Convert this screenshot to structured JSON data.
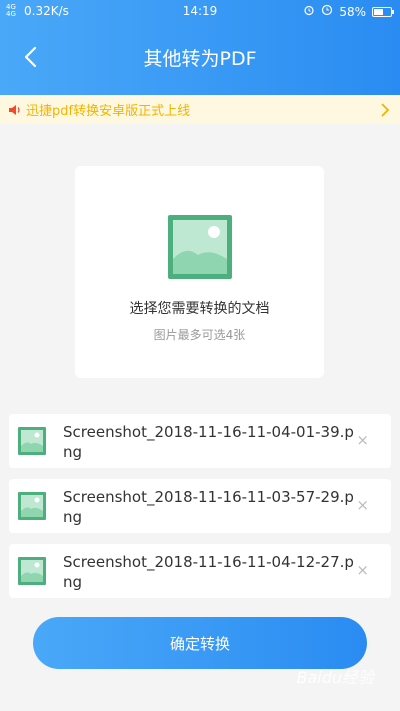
{
  "status_bar": {
    "network": "4G 4G",
    "speed": "0.32K/s",
    "time": "14:19",
    "battery": "58%"
  },
  "header": {
    "title": "其他转为PDF"
  },
  "notice": {
    "text": "迅捷pdf转换安卓版正式上线"
  },
  "upload": {
    "title": "选择您需要转换的文档",
    "subtitle": "图片最多可选4张"
  },
  "files": [
    {
      "name": "Screenshot_2018-11-16-11-04-01-39.png",
      "remove": "×"
    },
    {
      "name": "Screenshot_2018-11-16-11-03-57-29.png",
      "remove": "×"
    },
    {
      "name": "Screenshot_2018-11-16-11-04-12-27.png",
      "remove": "×"
    }
  ],
  "confirm_button": {
    "label": "确定转换"
  },
  "watermark": "Baidu经验",
  "colors": {
    "primary": "#2a8cf2",
    "notice_bg": "#fff8e1",
    "notice_text": "#f0b400",
    "image_icon": "#4caf7d"
  }
}
